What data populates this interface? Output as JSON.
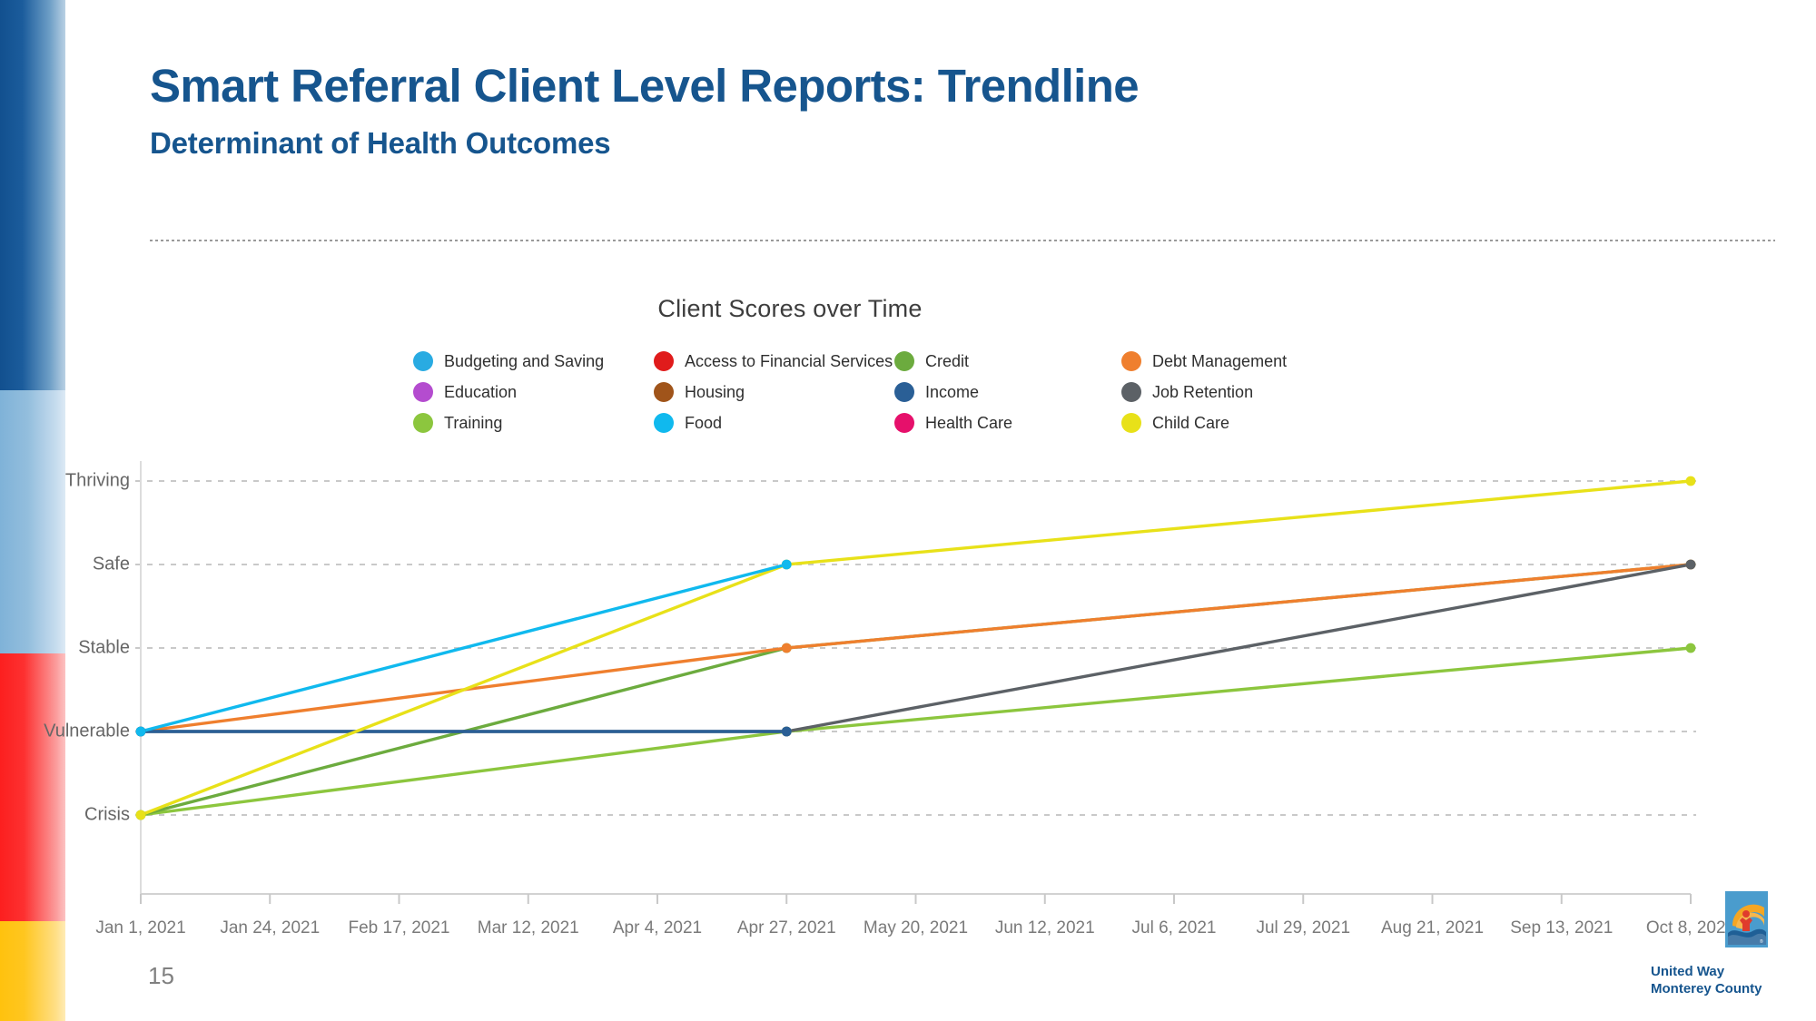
{
  "slide": {
    "title": "Smart Referral Client Level Reports: Trendline",
    "subtitle": "Determinant of Health Outcomes",
    "page_number": "15"
  },
  "footer": {
    "org_line1": "United Way",
    "org_line2": "Monterey County",
    "logo_icon": "united-way-logo-icon"
  },
  "legend": {
    "rows": [
      [
        {
          "label": "Budgeting and Saving",
          "color": "#29abe2"
        },
        {
          "label": "Access to Financial Services",
          "color": "#e01b1b"
        },
        {
          "label": "Credit",
          "color": "#6cab3e"
        },
        {
          "label": "Debt Management",
          "color": "#ef7f2e"
        }
      ],
      [
        {
          "label": "Education",
          "color": "#b44ccf"
        },
        {
          "label": "Housing",
          "color": "#a0541a"
        },
        {
          "label": "Income",
          "color": "#2a5f96"
        },
        {
          "label": "Job Retention",
          "color": "#5c6166"
        }
      ],
      [
        {
          "label": "Training",
          "color": "#8cc63e"
        },
        {
          "label": "Food",
          "color": "#10b9ee"
        },
        {
          "label": "Health Care",
          "color": "#e6106b"
        },
        {
          "label": "Child Care",
          "color": "#e8e119"
        }
      ]
    ]
  },
  "chart_data": {
    "type": "line",
    "title": "Client Scores over Time",
    "xlabel": "",
    "ylabel": "",
    "grid": true,
    "legend_position": "top",
    "y_categories": [
      "Crisis",
      "Vulnerable",
      "Stable",
      "Safe",
      "Thriving"
    ],
    "ylim": [
      0,
      4
    ],
    "x_tick_labels": [
      "Jan 1, 2021",
      "Jan 24, 2021",
      "Feb 17, 2021",
      "Mar 12, 2021",
      "Apr 4, 2021",
      "Apr 27, 2021",
      "May 20, 2021",
      "Jun 12, 2021",
      "Jul 6, 2021",
      "Jul 29, 2021",
      "Aug 21, 2021",
      "Sep 13, 2021",
      "Oct 8, 2021"
    ],
    "x_plotted_dates": [
      "Jan 1, 2021",
      "Apr 27, 2021",
      "Oct 8, 2021"
    ],
    "series": [
      {
        "name": "Budgeting and Saving",
        "color": "#29abe2",
        "x": [],
        "values": []
      },
      {
        "name": "Access to Financial Services",
        "color": "#e01b1b",
        "x": [],
        "values": []
      },
      {
        "name": "Credit",
        "color": "#6cab3e",
        "x": [
          "Jan 1, 2021",
          "Apr 27, 2021",
          "Oct 8, 2021"
        ],
        "values": [
          "Crisis",
          "Stable",
          "Safe"
        ]
      },
      {
        "name": "Debt Management",
        "color": "#ef7f2e",
        "x": [
          "Jan 1, 2021",
          "Apr 27, 2021",
          "Oct 8, 2021"
        ],
        "values": [
          "Vulnerable",
          "Stable",
          "Safe"
        ]
      },
      {
        "name": "Education",
        "color": "#b44ccf",
        "x": [],
        "values": []
      },
      {
        "name": "Housing",
        "color": "#a0541a",
        "x": [],
        "values": []
      },
      {
        "name": "Income",
        "color": "#2a5f96",
        "x": [
          "Jan 1, 2021",
          "Apr 27, 2021"
        ],
        "values": [
          "Vulnerable",
          "Vulnerable"
        ]
      },
      {
        "name": "Job Retention",
        "color": "#5c6166",
        "x": [
          "Jan 1, 2021",
          "Apr 27, 2021",
          "Oct 8, 2021"
        ],
        "values": [
          "Vulnerable",
          "Vulnerable",
          "Safe"
        ]
      },
      {
        "name": "Training",
        "color": "#8cc63e",
        "x": [
          "Jan 1, 2021",
          "Apr 27, 2021",
          "Oct 8, 2021"
        ],
        "values": [
          "Crisis",
          "Vulnerable",
          "Stable"
        ]
      },
      {
        "name": "Food",
        "color": "#10b9ee",
        "x": [
          "Jan 1, 2021",
          "Apr 27, 2021"
        ],
        "values": [
          "Vulnerable",
          "Safe"
        ]
      },
      {
        "name": "Health Care",
        "color": "#e6106b",
        "x": [],
        "values": []
      },
      {
        "name": "Child Care",
        "color": "#e8e119",
        "x": [
          "Jan 1, 2021",
          "Apr 27, 2021",
          "Oct 8, 2021"
        ],
        "values": [
          "Crisis",
          "Safe",
          "Thriving"
        ]
      }
    ]
  },
  "colors": {
    "brand_blue": "#16558e",
    "band_dark_blue": "#12508f",
    "band_light_blue": "#7fb2d8",
    "band_red": "#fc1f1f",
    "band_yellow": "#ffc20e"
  }
}
